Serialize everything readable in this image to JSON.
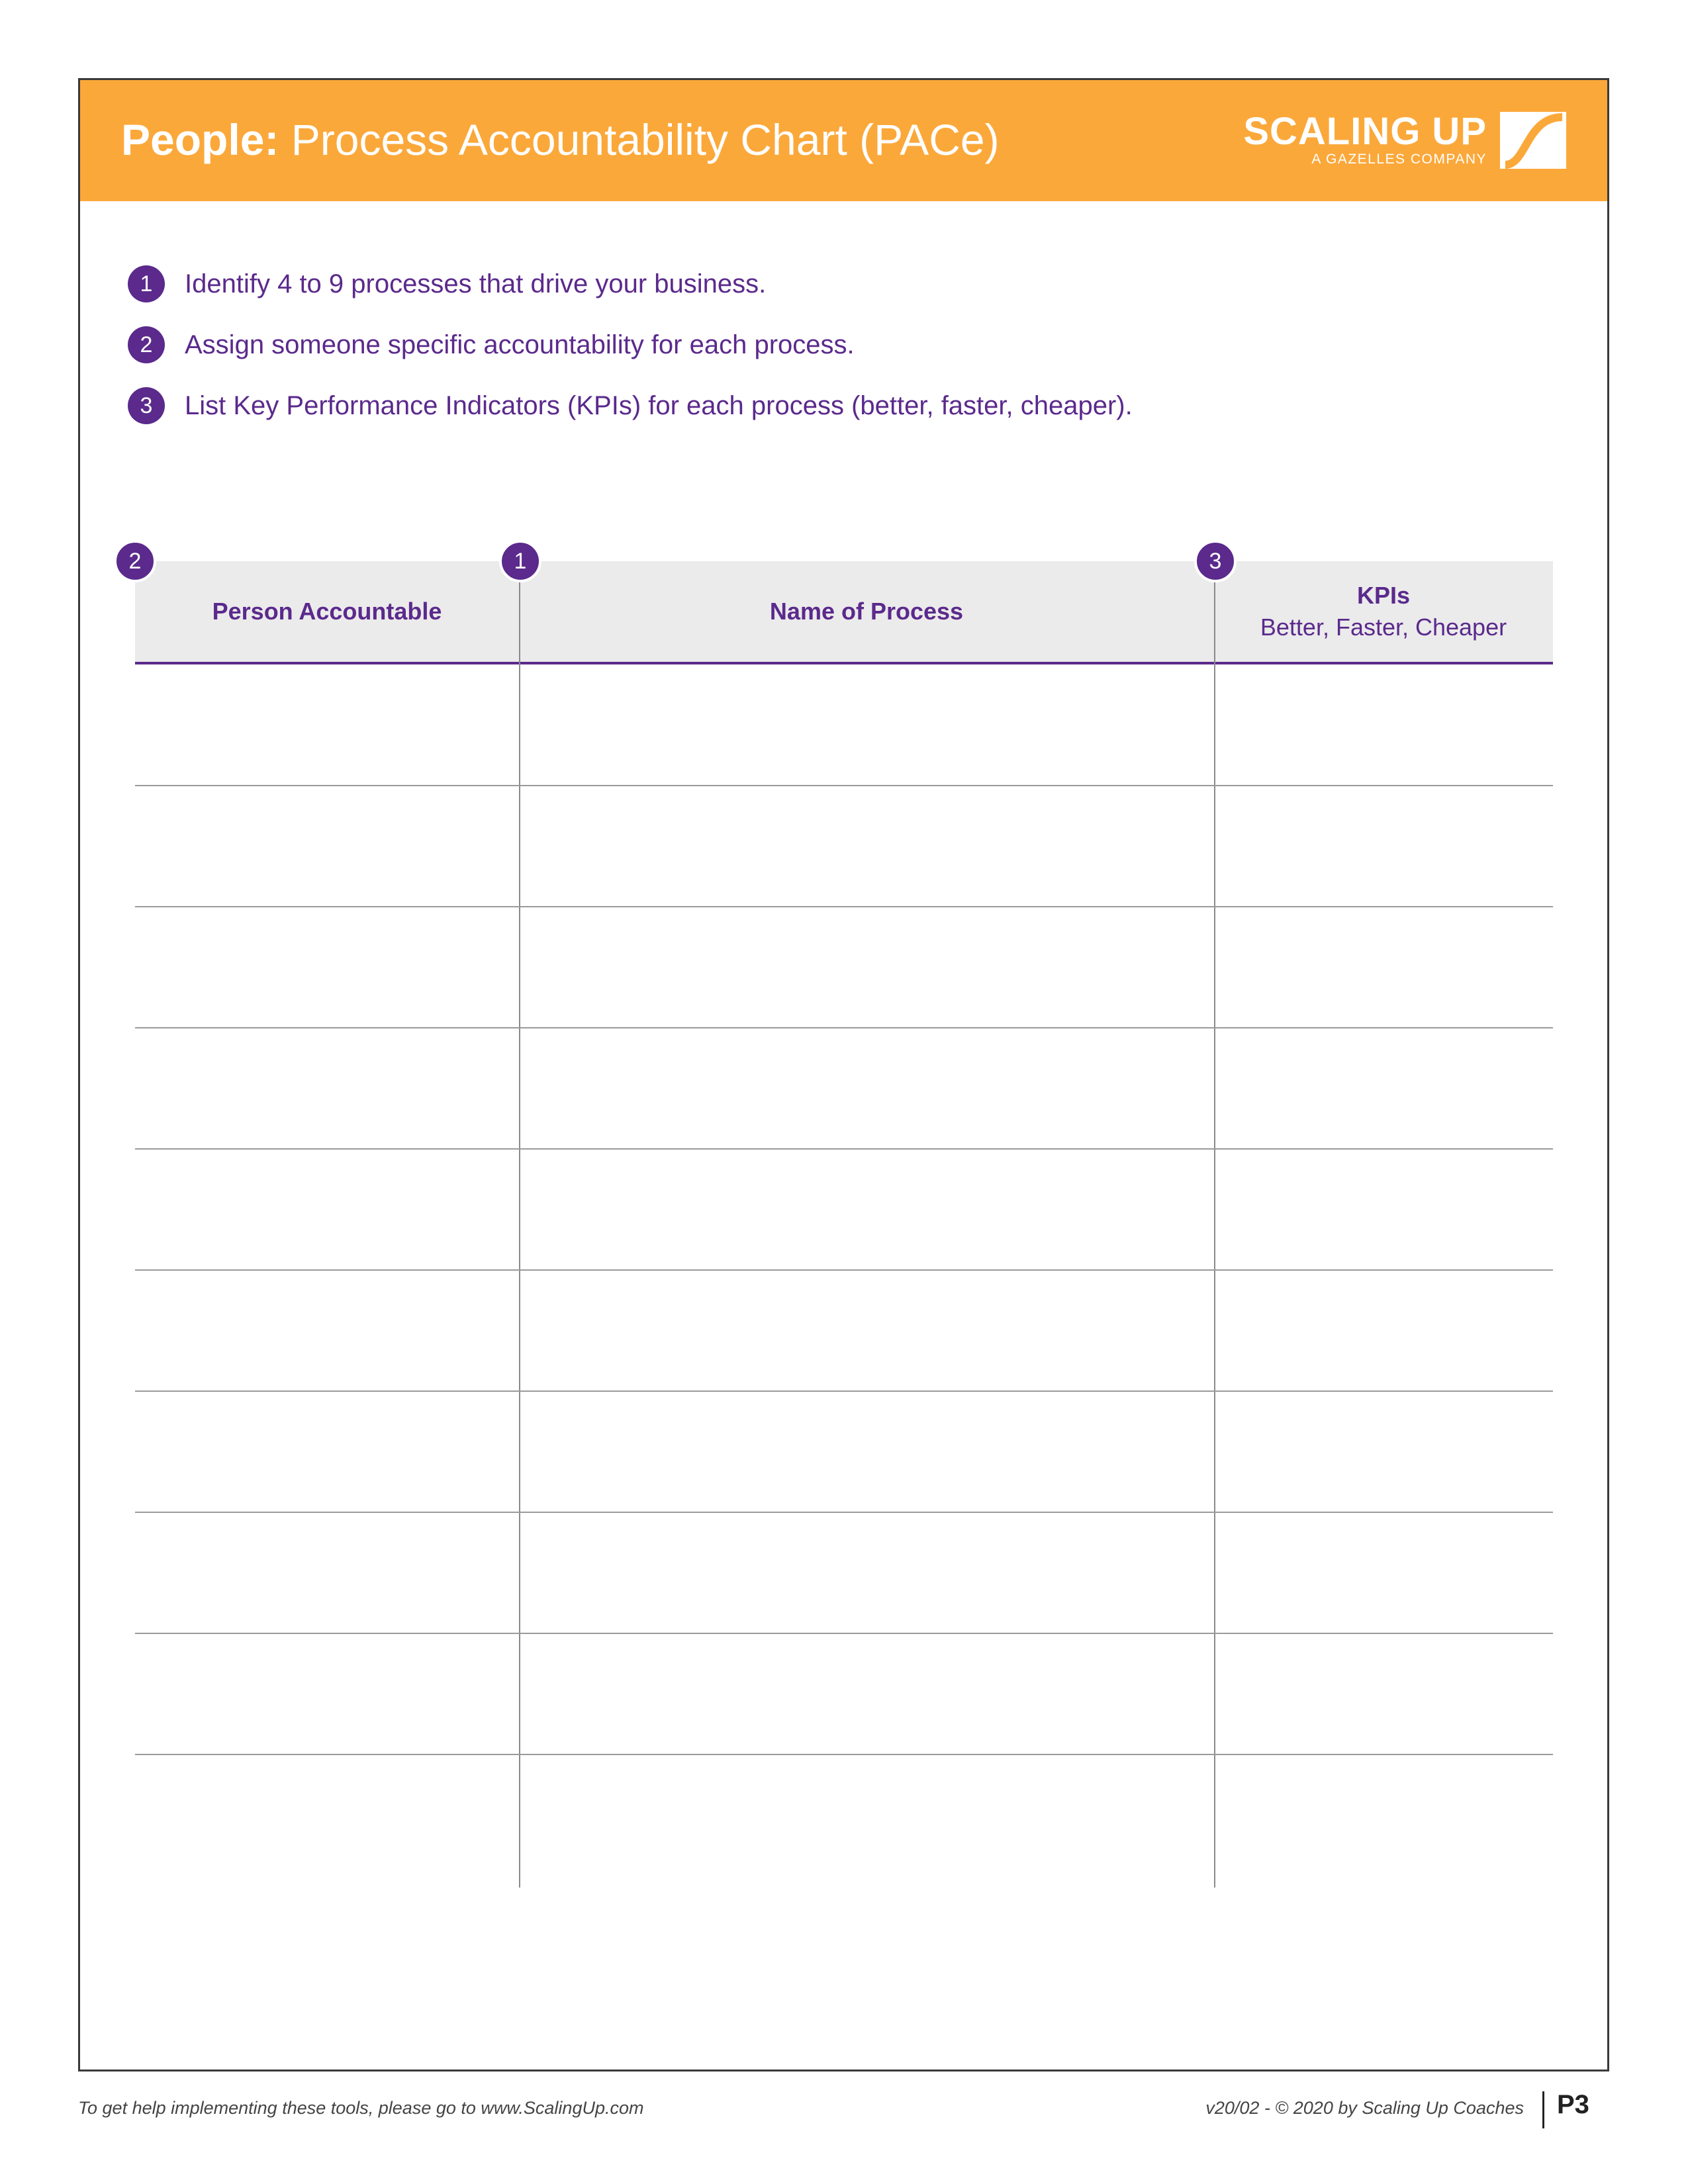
{
  "header": {
    "title_bold": "People:",
    "title_rest": "Process Accountability Chart (PACe)",
    "logo_word": "SCALING UP",
    "logo_sub": "A GAZELLES COMPANY",
    "bg_color": "#fba83a"
  },
  "steps": [
    {
      "num": "1",
      "text": "Identify 4 to 9 processes that drive your business."
    },
    {
      "num": "2",
      "text": "Assign someone specific accountability for each process."
    },
    {
      "num": "3",
      "text": "List Key Performance Indicators (KPIs) for each process (better, faster, cheaper)."
    }
  ],
  "table": {
    "columns": [
      {
        "badge": "2",
        "label": "Person Accountable",
        "sub": ""
      },
      {
        "badge": "1",
        "label": "Name of Process",
        "sub": ""
      },
      {
        "badge": "3",
        "label": "KPIs",
        "sub": "Better, Faster, Cheaper"
      }
    ],
    "rows": [
      [
        "",
        "",
        ""
      ],
      [
        "",
        "",
        ""
      ],
      [
        "",
        "",
        ""
      ],
      [
        "",
        "",
        ""
      ],
      [
        "",
        "",
        ""
      ],
      [
        "",
        "",
        ""
      ],
      [
        "",
        "",
        ""
      ],
      [
        "",
        "",
        ""
      ],
      [
        "",
        "",
        ""
      ],
      [
        "",
        "",
        ""
      ]
    ]
  },
  "footer": {
    "left": "To get help implementing these tools, please go to www.ScalingUp.com",
    "right": "v20/02 - © 2020 by Scaling Up Coaches",
    "page": "P3"
  },
  "colors": {
    "accent": "#5b2a8c",
    "header_bg": "#fba83a",
    "table_header_bg": "#ebebeb"
  }
}
